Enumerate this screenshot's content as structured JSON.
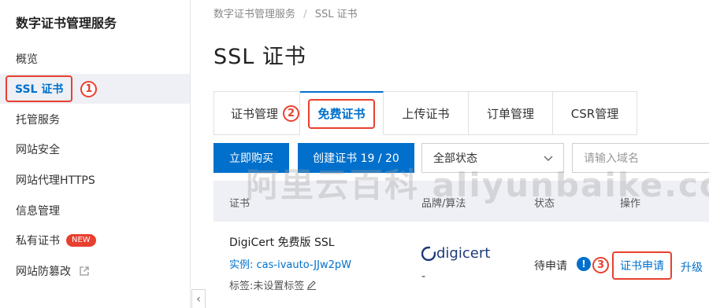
{
  "sidebar": {
    "title": "数字证书管理服务",
    "items": [
      {
        "label": "概览"
      },
      {
        "label": "SSL 证书"
      },
      {
        "label": "托管服务"
      },
      {
        "label": "网站安全"
      },
      {
        "label": "网站代理HTTPS"
      },
      {
        "label": "信息管理"
      },
      {
        "label": "私有证书",
        "badge": "NEW"
      },
      {
        "label": "网站防篡改"
      }
    ],
    "collapse_glyph": "‹"
  },
  "annotations": {
    "step1": "1",
    "step2": "2",
    "step3": "3"
  },
  "breadcrumb": {
    "root": "数字证书管理服务",
    "separator": "/",
    "current": "SSL 证书"
  },
  "page_title": "SSL 证书",
  "tabs": [
    {
      "label": "证书管理"
    },
    {
      "label": "免费证书",
      "active": true
    },
    {
      "label": "上传证书"
    },
    {
      "label": "订单管理"
    },
    {
      "label": "CSR管理"
    }
  ],
  "toolbar": {
    "buy_label": "立即购买",
    "create_label": "创建证书 19 / 20",
    "status_select": "全部状态",
    "search_placeholder": "请输入域名"
  },
  "table": {
    "headers": [
      "证书",
      "品牌/算法",
      "状态",
      "操作"
    ],
    "rows": [
      {
        "name": "DigiCert 免费版 SSL",
        "instance": "实例: cas-ivauto-JJw2pW",
        "tags": "标签:未设置标签",
        "brand": "digicert",
        "algorithm": "-",
        "status": "待申请",
        "actions": {
          "apply": "证书申请",
          "upgrade": "升级"
        }
      }
    ]
  },
  "watermark": "阿里云百科 aliyunbaike.com",
  "colors": {
    "primary": "#0070cc",
    "annotation": "#e8402f",
    "header_bg": "#eef0f5"
  }
}
